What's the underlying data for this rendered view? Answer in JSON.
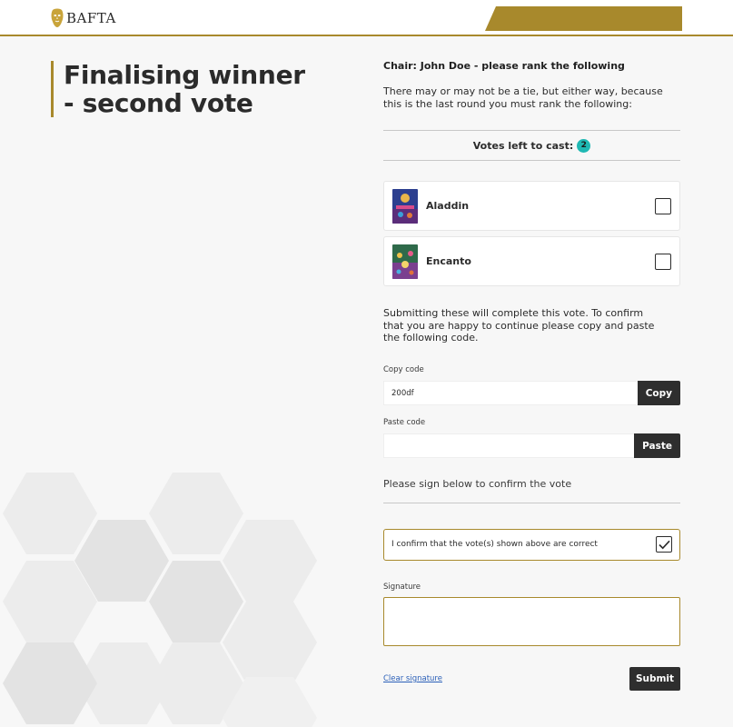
{
  "header": {
    "logo_text": "BAFTA",
    "logo_icon": "bafta-mask-icon",
    "brand_color": "#a8892c"
  },
  "page": {
    "title": "Finalising winner - second vote"
  },
  "panel": {
    "chair_text": "Chair: John Doe - please rank the following",
    "intro_text": "There may or may not be a tie, but either way, because this is the last round you must rank the following:",
    "votes_label": "Votes left to cast:",
    "votes_left": "2",
    "badge_color": "#1fb8b3",
    "films": [
      {
        "name": "Aladdin",
        "checked": false
      },
      {
        "name": "Encanto",
        "checked": false
      }
    ],
    "submit_note": "Submitting these will complete this vote. To confirm that you are happy to continue please copy and paste the following code.",
    "copy_code_label": "Copy code",
    "copy_code_value": "200df",
    "copy_button": "Copy",
    "paste_code_label": "Paste code",
    "paste_code_value": "",
    "paste_button": "Paste",
    "sign_note": "Please sign below to confirm the vote",
    "confirm_text": "I confirm that the vote(s) shown above are correct",
    "confirm_checked": true,
    "signature_label": "Signature",
    "clear_signature": "Clear signature",
    "submit_button": "Submit"
  }
}
